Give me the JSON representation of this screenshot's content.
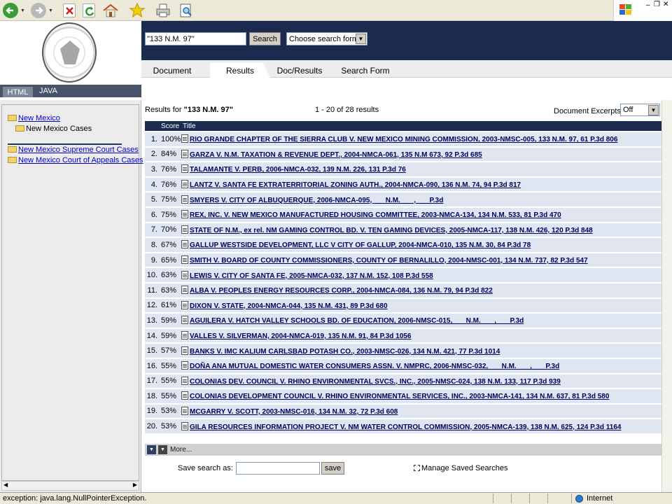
{
  "browser": {
    "tools": [
      "back-icon",
      "forward-icon",
      "stop-icon",
      "refresh-icon",
      "home-icon",
      "favorites-icon",
      "print-icon",
      "print-preview-icon"
    ],
    "window_controls": [
      "minimize-icon",
      "restore-icon",
      "close-icon"
    ]
  },
  "search": {
    "query_value": "\"133 N.M. 97\"",
    "button_label": "Search",
    "form_select": "Choose search form"
  },
  "tabs": [
    {
      "label": "Document"
    },
    {
      "label": "Results"
    },
    {
      "label": "Doc/Results"
    },
    {
      "label": "Search Form"
    }
  ],
  "lang": {
    "html": "HTML",
    "java": "JAVA"
  },
  "tree": {
    "root": "New Mexico",
    "child": "New Mexico Cases",
    "items": [
      "New Mexico Supreme Court Cases",
      "New Mexico Court of Appeals Cases"
    ]
  },
  "results": {
    "prefix": "Results for ",
    "query": "\"133 N.M. 97\"",
    "count": "1 - 20 of 28 results",
    "excerpts_label": "Document Excerpts:",
    "excerpts_value": "Off",
    "columns": {
      "score": "Score",
      "title": "Title"
    },
    "rows": [
      {
        "n": "1.",
        "score": "100%",
        "title": "RIO GRANDE CHAPTER OF THE SIERRA CLUB V. NEW MEXICO MINING COMMISSION, 2003-NMSC-005, 133 N.M. 97, 61 P.3d 806"
      },
      {
        "n": "2.",
        "score": "84%",
        "title": "GARZA V. N.M. TAXATION & REVENUE DEPT., 2004-NMCA-061, 135 N.M 673, 92 P.3d 685"
      },
      {
        "n": "3.",
        "score": "76%",
        "title": "TALAMANTE V. PERB, 2006-NMCA-032, 139 N.M. 226, 131 P.3d 76"
      },
      {
        "n": "4.",
        "score": "76%",
        "title": "LANTZ V. SANTA FE EXTRATERRITORIAL ZONING AUTH., 2004-NMCA-090, 136 N.M. 74, 94 P.3d 817"
      },
      {
        "n": "5.",
        "score": "75%",
        "title": "SMYERS V. CITY OF ALBUQUERQUE, 2006-NMCA-095,       N.M.       ,       P.3d"
      },
      {
        "n": "6.",
        "score": "75%",
        "title": "REX, INC. V. NEW MEXICO MANUFACTURED HOUSING COMMITTEE, 2003-NMCA-134, 134 N.M. 533, 81 P.3d 470"
      },
      {
        "n": "7.",
        "score": "70%",
        "title": "STATE OF N.M., ex rel. NM GAMING CONTROL BD. V. TEN GAMING DEVICES, 2005-NMCA-117, 138 N.M. 426, 120 P.3d 848"
      },
      {
        "n": "8.",
        "score": "67%",
        "title": "GALLUP WESTSIDE DEVELOPMENT, LLC V CITY OF GALLUP, 2004-NMCA-010, 135 N.M. 30, 84 P.3d 78"
      },
      {
        "n": "9.",
        "score": "65%",
        "title": "SMITH V. BOARD OF COUNTY COMMISSIONERS, COUNTY OF BERNALILLO, 2004-NMSC-001, 134 N.M. 737, 82 P.3d 547"
      },
      {
        "n": "10.",
        "score": "63%",
        "title": "LEWIS V. CITY OF SANTA FE, 2005-NMCA-032, 137 N.M. 152, 108 P.3d 558"
      },
      {
        "n": "11.",
        "score": "63%",
        "title": "ALBA V. PEOPLES ENERGY RESOURCES CORP., 2004-NMCA-084, 136 N.M. 79, 94 P.3d 822"
      },
      {
        "n": "12.",
        "score": "61%",
        "title": "DIXON V. STATE, 2004-NMCA-044, 135 N.M. 431, 89 P.3d 680"
      },
      {
        "n": "13.",
        "score": "59%",
        "title": "AGUILERA V. HATCH VALLEY SCHOOLS BD. OF EDUCATION, 2006-NMSC-015,       N.M.       ,       P.3d"
      },
      {
        "n": "14.",
        "score": "59%",
        "title": "VALLES V. SILVERMAN, 2004-NMCA-019, 135 N.M. 91, 84 P.3d 1056"
      },
      {
        "n": "15.",
        "score": "57%",
        "title": "BANKS V. IMC KALIUM CARLSBAD POTASH CO., 2003-NMSC-026, 134 N.M. 421, 77 P.3d 1014"
      },
      {
        "n": "16.",
        "score": "55%",
        "title": "DOÑA ANA MUTUAL DOMESTIC WATER CONSUMERS ASSN. V. NMPRC, 2006-NMSC-032,       N.M.       ,       P.3d"
      },
      {
        "n": "17.",
        "score": "55%",
        "title": "COLONIAS DEV. COUNCIL V. RHINO ENVIRONMENTAL SVCS., INC., 2005-NMSC-024, 138 N.M. 133, 117 P.3d 939"
      },
      {
        "n": "18.",
        "score": "55%",
        "title": "COLONIAS DEVELOPMENT COUNCIL V. RHINO ENVIRONMENTAL SERVICES, INC., 2003-NMCA-141, 134 N.M. 637, 81 P.3d 580"
      },
      {
        "n": "19.",
        "score": "53%",
        "title": "MCGARRY V. SCOTT, 2003-NMSC-016, 134 N.M. 32, 72 P.3d 608"
      },
      {
        "n": "20.",
        "score": "53%",
        "title": "GILA RESOURCES INFORMATION PROJECT V. NM WATER CONTROL COMMISSION, 2005-NMCA-139, 138 N.M. 625, 124 P.3d 1164"
      }
    ]
  },
  "pager": {
    "more": "More..."
  },
  "save": {
    "label": "Save search as:",
    "button": "save",
    "manage": "Manage Saved Searches"
  },
  "status": {
    "text": "exception: java.lang.NullPointerException.",
    "zone": "Internet"
  },
  "colors": {
    "navy": "#1b2a4e",
    "row": "#dfe6f2",
    "link": "#0000cc"
  }
}
